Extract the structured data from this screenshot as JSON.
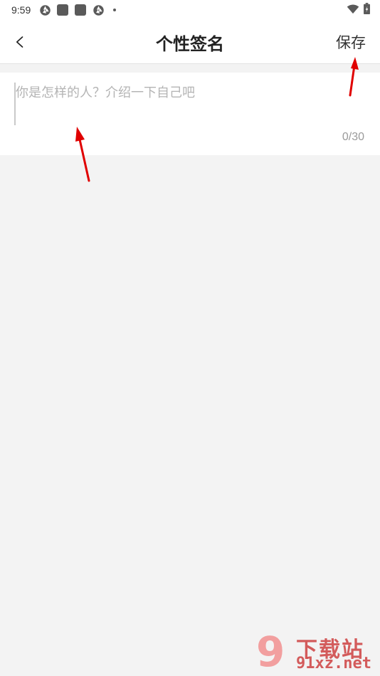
{
  "status_bar": {
    "time": "9:59",
    "left_icons": [
      "aperture-icon",
      "app-square-icon",
      "app-square-icon",
      "aperture-icon",
      "dot-icon"
    ],
    "right_icons": [
      "wifi-icon",
      "battery-icon"
    ]
  },
  "header": {
    "title": "个性签名",
    "back_icon": "chevron-left-icon",
    "save_label": "保存"
  },
  "editor": {
    "placeholder": "你是怎样的人？介绍一下自己吧",
    "value": "",
    "char_count": "0/30"
  },
  "annotation": {
    "color": "#e00000"
  },
  "watermark": {
    "digit": "9",
    "site_name": "下载站",
    "domain": "91xz.net"
  },
  "colors": {
    "background": "#f3f3f3",
    "surface": "#ffffff",
    "placeholder": "#b4b4b4",
    "counter": "#9a9a9a"
  }
}
